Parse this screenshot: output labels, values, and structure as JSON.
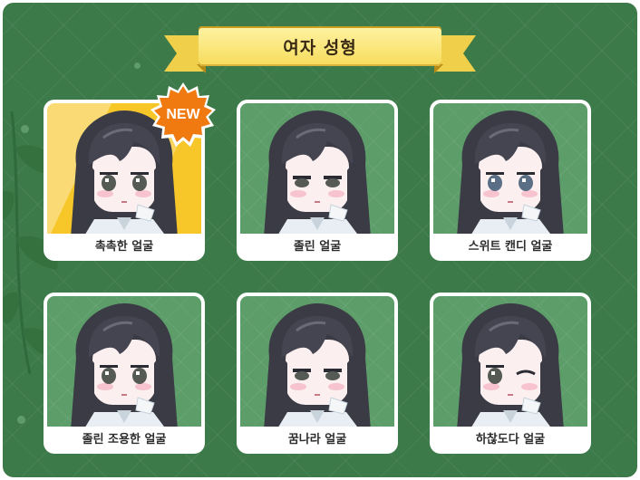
{
  "title": "여자 성형",
  "badge": {
    "label": "NEW"
  },
  "cards": [
    {
      "label": "촉촉한 얼굴",
      "eyes": "round",
      "featured": true
    },
    {
      "label": "졸린 얼굴",
      "eyes": "sleepy"
    },
    {
      "label": "스위트 캔디 얼굴",
      "eyes": "sweet"
    },
    {
      "label": "졸린 조용한 얼굴",
      "eyes": "round"
    },
    {
      "label": "꿈나라 얼굴",
      "eyes": "dreamy"
    },
    {
      "label": "하찮도다 얼굴",
      "eyes": "smug"
    }
  ],
  "colors": {
    "background": "#3d7a4a",
    "card_art": "#5d9d69",
    "featured_art": "#f7c72a",
    "ribbon": "#f6dc5a",
    "badge": "#f07a10"
  }
}
